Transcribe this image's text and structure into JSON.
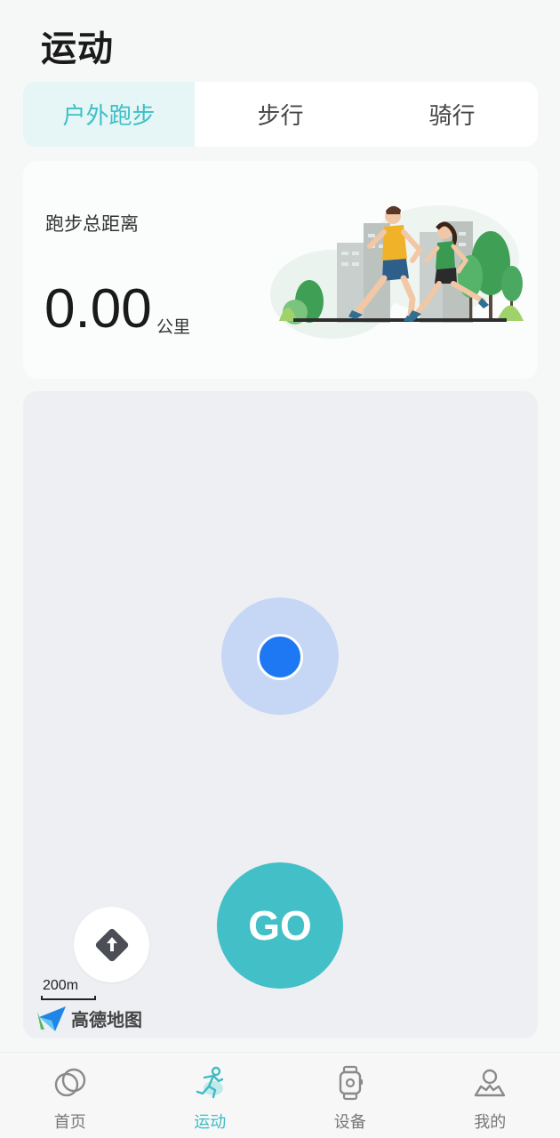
{
  "header": {
    "title": "运动"
  },
  "tabs": [
    {
      "label": "户外跑步",
      "active": true
    },
    {
      "label": "步行",
      "active": false
    },
    {
      "label": "骑行",
      "active": false
    }
  ],
  "summary": {
    "label": "跑步总距离",
    "value": "0.00",
    "unit": "公里",
    "illustration": "runners-illustration"
  },
  "map": {
    "go_label": "GO",
    "scale_label": "200m",
    "logo_text": "高德地图",
    "location_color": "#1f78f3"
  },
  "bottom_nav": [
    {
      "label": "首页",
      "icon": "home-circles-icon",
      "active": false
    },
    {
      "label": "运动",
      "icon": "runner-icon",
      "active": true
    },
    {
      "label": "设备",
      "icon": "watch-icon",
      "active": false
    },
    {
      "label": "我的",
      "icon": "profile-icon",
      "active": false
    }
  ],
  "colors": {
    "accent": "#43c0c7",
    "active_tab_bg": "#e6f5f6"
  }
}
